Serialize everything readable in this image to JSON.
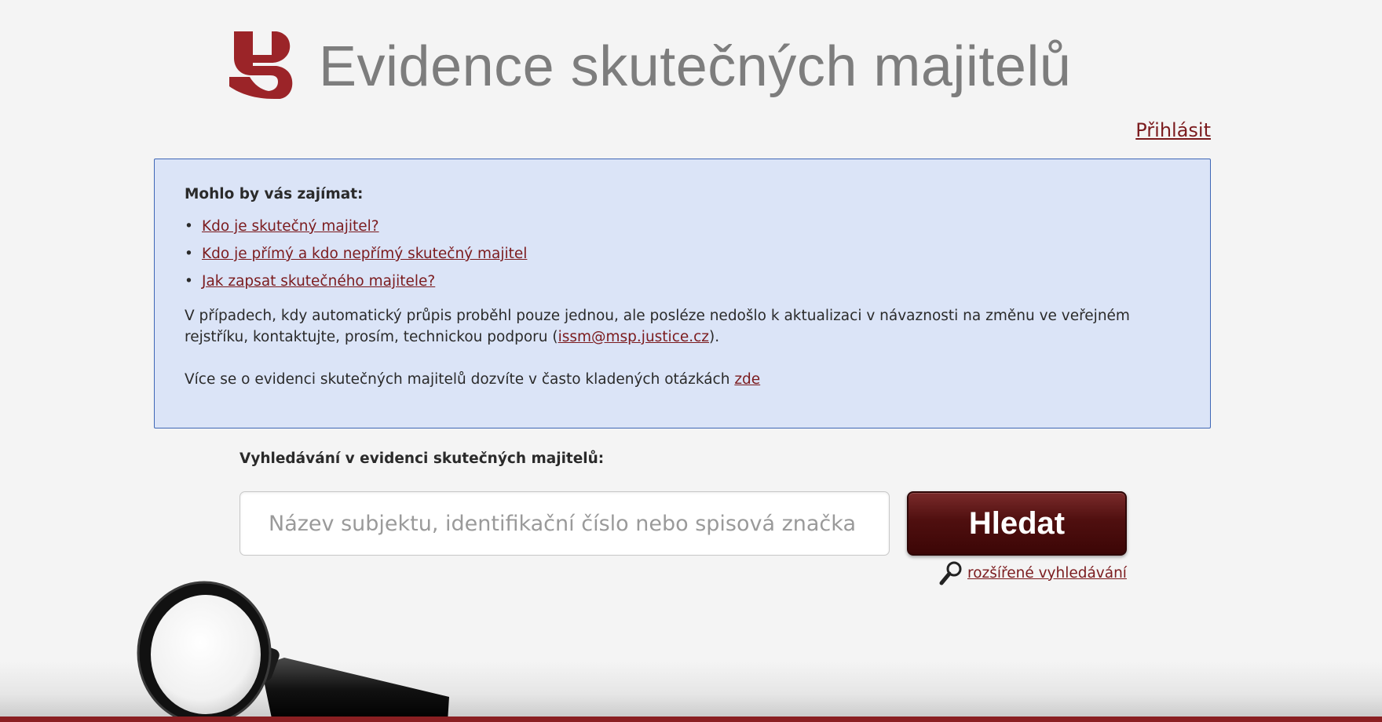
{
  "header": {
    "title": "Evidence skutečných majitelů"
  },
  "nav": {
    "login_label": "Přihlásit"
  },
  "info_box": {
    "heading": "Mohlo by vás zajímat:",
    "links": [
      {
        "label": "Kdo je skutečný majitel?"
      },
      {
        "label": "Kdo je přímý a kdo nepřímý skutečný majitel"
      },
      {
        "label": "Jak zapsat skutečného majitele?"
      }
    ],
    "paragraph1_text": "V případech, kdy automatický průpis proběhl pouze jednou, ale posléze nedošlo k aktualizaci v návaznosti na změnu ve veřejném rejstříku, kontaktujte, prosím, technickou podporu (",
    "support_email": "issm@msp.justice.cz",
    "paragraph1_end": ").",
    "paragraph2_text": "Více se o evidenci skutečných majitelů dozvíte v často kladených otázkách ",
    "faq_link": "zde"
  },
  "search": {
    "heading": "Vyhledávání v evidenci skutečných majitelů:",
    "placeholder": "Název subjektu, identifikační číslo nebo spisová značka",
    "value": "",
    "button_label": "Hledat",
    "advanced_label": "rozšířené vyhledávání"
  },
  "colors": {
    "accent": "#7b1b1e",
    "info_bg": "#dbe4f7",
    "info_border": "#3f67b6",
    "title_gray": "#7d7d7d"
  },
  "icons": {
    "logo": "justice-s-logo",
    "advanced": "magnifier-icon",
    "decoration": "magnifying-glass-decoration"
  }
}
